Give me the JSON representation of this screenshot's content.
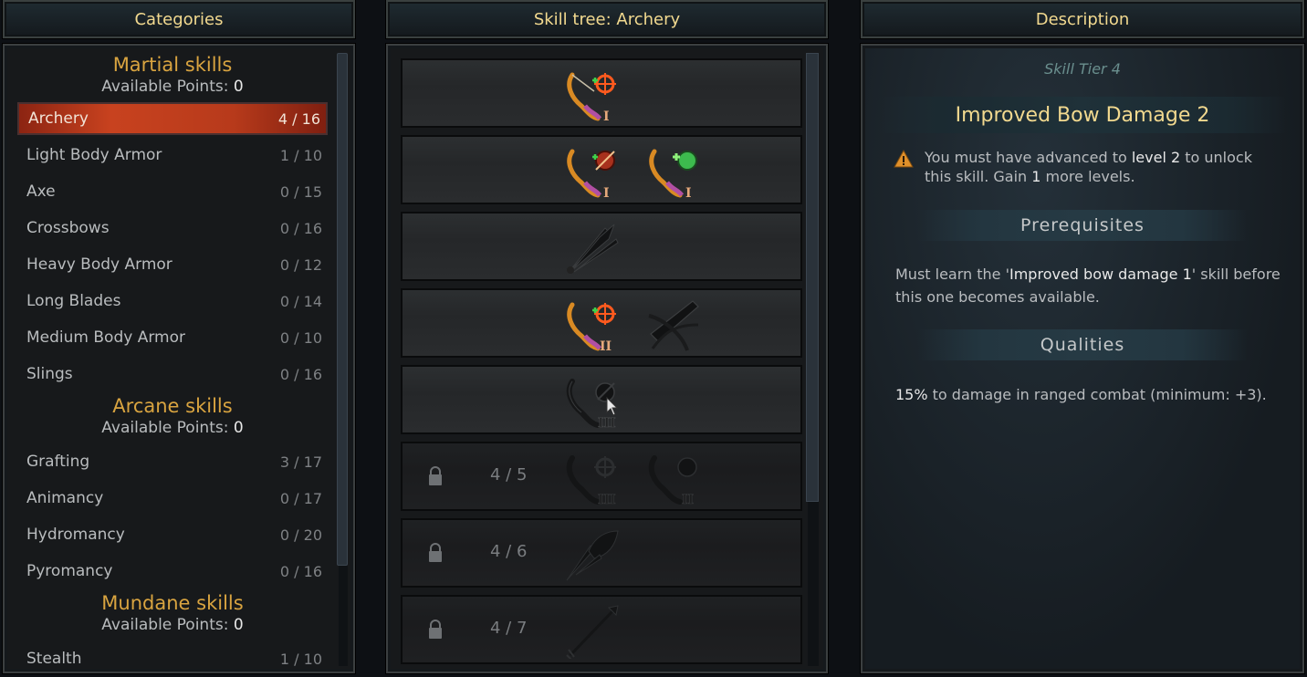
{
  "categories": {
    "title": "Categories",
    "groups": [
      {
        "title": "Martial skills",
        "points_label": "Available Points:",
        "points": "0",
        "items": [
          {
            "label": "Archery",
            "count": "4 / 16"
          },
          {
            "label": "Light Body Armor",
            "count": "1 / 10"
          },
          {
            "label": "Axe",
            "count": "0 / 15"
          },
          {
            "label": "Crossbows",
            "count": "0 / 16"
          },
          {
            "label": "Heavy Body Armor",
            "count": "0 / 12"
          },
          {
            "label": "Long Blades",
            "count": "0 / 14"
          },
          {
            "label": "Medium Body Armor",
            "count": "0 / 10"
          },
          {
            "label": "Slings",
            "count": "0 / 16"
          }
        ]
      },
      {
        "title": "Arcane skills",
        "points_label": "Available Points:",
        "points": "0",
        "items": [
          {
            "label": "Grafting",
            "count": "3 / 17"
          },
          {
            "label": "Animancy",
            "count": "0 / 17"
          },
          {
            "label": "Hydromancy",
            "count": "0 / 20"
          },
          {
            "label": "Pyromancy",
            "count": "0 / 16"
          }
        ]
      },
      {
        "title": "Mundane skills",
        "points_label": "Available Points:",
        "points": "0",
        "items": [
          {
            "label": "Stealth",
            "count": "1 / 10"
          }
        ]
      }
    ]
  },
  "tree": {
    "title": "Skill tree: Archery",
    "locked_counts": [
      "4 / 5",
      "4 / 6",
      "4 / 7"
    ],
    "icons": [
      "bow-target-icon",
      "bow-damage-icon",
      "bow-heal-icon",
      "arrow-volley-icon",
      "bow-target-2-icon",
      "crossbow-icon",
      "bow-damage-3-icon",
      "bow-target-3-icon",
      "bow-damage-3b-icon",
      "arrow-feather-icon",
      "single-arrow-icon"
    ]
  },
  "description": {
    "title": "Description",
    "tier": "Skill Tier 4",
    "skill_name": "Improved Bow Damage 2",
    "warning": {
      "p1": "You must have advanced to ",
      "level": "level 2",
      "p2": " to unlock this skill. Gain ",
      "gain": "1",
      "p3": " more levels."
    },
    "prereq_title": "Prerequisites",
    "prereq": {
      "p1": "Must learn the '",
      "skill": "Improved bow damage 1",
      "p2": "' skill before this one becomes available."
    },
    "qualities_title": "Qualities",
    "quality": {
      "value": "15%",
      "text": " to damage in ranged combat (minimum: +3)."
    }
  },
  "colors": {
    "accent_gold": "#d9a440",
    "selected_red": "#c8421f",
    "header_text": "#f2d98f"
  }
}
